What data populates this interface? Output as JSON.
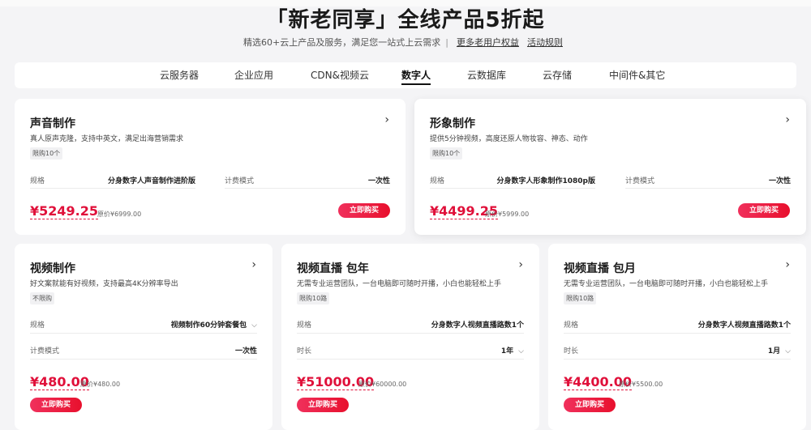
{
  "header": {
    "title": "「新老同享」全线产品5折起",
    "subtitle": "精选60+云上产品及服务，满足您一站式上云需求",
    "separator": "|",
    "link_more": "更多老用户权益",
    "link_rules": "活动规则"
  },
  "tabs": [
    {
      "label": "云服务器",
      "active": false
    },
    {
      "label": "企业应用",
      "active": false
    },
    {
      "label": "CDN&视频云",
      "active": false
    },
    {
      "label": "数字人",
      "active": true
    },
    {
      "label": "云数据库",
      "active": false
    },
    {
      "label": "云存储",
      "active": false
    },
    {
      "label": "中间件&其它",
      "active": false
    }
  ],
  "cards": {
    "voice": {
      "title": "声音制作",
      "arrow": "›",
      "desc": "真人原声克隆，支持中英文，满足出海营销需求",
      "badge": "限购10个",
      "spec_label": "规格",
      "spec_value": "分身数字人声音制作进阶版",
      "billing_label": "计费模式",
      "billing_value": "一次性",
      "price": "¥5249.25",
      "orig": "原价¥6999.00",
      "buy": "立即购买"
    },
    "image": {
      "title": "形象制作",
      "arrow": "›",
      "desc": "提供5分钟视频，高度还原人物妆容、神态、动作",
      "badge": "限购10个",
      "spec_label": "规格",
      "spec_value": "分身数字人形象制作1080p版",
      "billing_label": "计费模式",
      "billing_value": "一次性",
      "price": "¥4499.25",
      "orig": "原价¥5999.00",
      "buy": "立即购买"
    },
    "video": {
      "title": "视频制作",
      "arrow": "›",
      "desc": "好文案就能有好视频，支持最高4K分辨率导出",
      "badge": "不限购",
      "spec_label": "规格",
      "spec_value": "视频制作60分钟套餐包",
      "chev": "⌵",
      "billing_label": "计费模式",
      "billing_value": "一次性",
      "price": "¥480.00",
      "orig": "原价¥480.00",
      "buy": "立即购买"
    },
    "live_year": {
      "title": "视频直播 包年",
      "arrow": "›",
      "desc": "无需专业运营团队，一台电脑即可随时开播，小白也能轻松上手",
      "badge": "限购10路",
      "spec_label": "规格",
      "spec_value": "分身数字人视频直播路数1个",
      "dur_label": "时长",
      "dur_value": "1年",
      "chev": "⌵",
      "price": "¥51000.00",
      "orig": "原价¥60000.00",
      "buy": "立即购买"
    },
    "live_month": {
      "title": "视频直播 包月",
      "arrow": "›",
      "desc": "无需专业运营团队，一台电脑即可随时开播，小白也能轻松上手",
      "badge": "限购10路",
      "spec_label": "规格",
      "spec_value": "分身数字人视频直播路数1个",
      "dur_label": "时长",
      "dur_value": "1月",
      "chev": "⌵",
      "price": "¥4400.00",
      "orig": "原价¥5500.00",
      "buy": "立即购买"
    }
  },
  "colors": {
    "accent": "#e0103a",
    "button": "#f0305c",
    "background": "#f4f4f6"
  }
}
